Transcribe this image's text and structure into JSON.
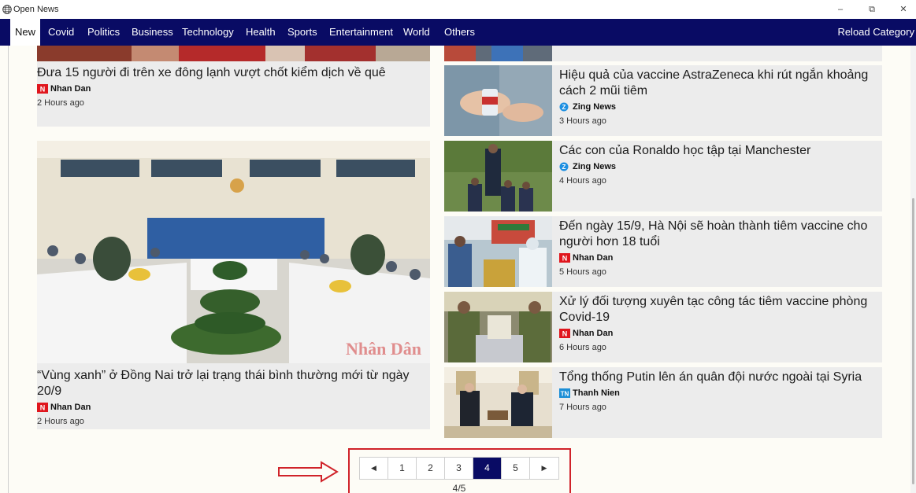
{
  "app": {
    "title": "Open News"
  },
  "window": {
    "min": "–",
    "max": "⧉",
    "close": "✕"
  },
  "nav": {
    "items": [
      "New",
      "Covid",
      "Politics",
      "Business",
      "Technology",
      "Health",
      "Sports",
      "Entertainment",
      "World",
      "Others"
    ],
    "active": "New",
    "reload": "Reload Category"
  },
  "articles": {
    "left_top": {
      "title": "Đưa 15 người đi trên xe đông lạnh vượt chốt kiểm dịch về quê",
      "source": "Nhan Dan",
      "time": "2 Hours ago"
    },
    "left_big": {
      "title": "“Vùng xanh” ở Đồng Nai trở lại trạng thái bình thường mới từ ngày 20/9",
      "source": "Nhan Dan",
      "time": "2 Hours ago",
      "watermark": "Nhân Dân"
    },
    "right": [
      {
        "title": "Hiệu quả của vaccine AstraZeneca khi rút ngắn khoảng cách 2 mũi tiêm",
        "source": "Zing News",
        "time": "3 Hours ago"
      },
      {
        "title": "Các con của Ronaldo học tập tại Manchester",
        "source": "Zing News",
        "time": "4 Hours ago"
      },
      {
        "title": "Đến ngày 15/9, Hà Nội sẽ hoàn thành tiêm vaccine cho người hơn 18 tuổi",
        "source": "Nhan Dan",
        "time": "5 Hours ago"
      },
      {
        "title": "Xử lý đối tượng xuyên tạc công tác tiêm vaccine phòng Covid-19",
        "source": "Nhan Dan",
        "time": "6 Hours ago"
      },
      {
        "title": "Tổng thống Putin lên án quân đội nước ngoài tại Syria",
        "source": "Thanh Nien",
        "time": "7 Hours ago"
      }
    ]
  },
  "pagination": {
    "prev": "◀",
    "pages": [
      "1",
      "2",
      "3",
      "4",
      "5"
    ],
    "current": "4",
    "next": "▶",
    "info": "4/5"
  },
  "colors": {
    "nav_bg": "#090b64",
    "highlight": "#d0232a",
    "nhandan": "#e0161d",
    "zing": "#1d8fe1",
    "thanhnien": "#1b8ed6"
  }
}
